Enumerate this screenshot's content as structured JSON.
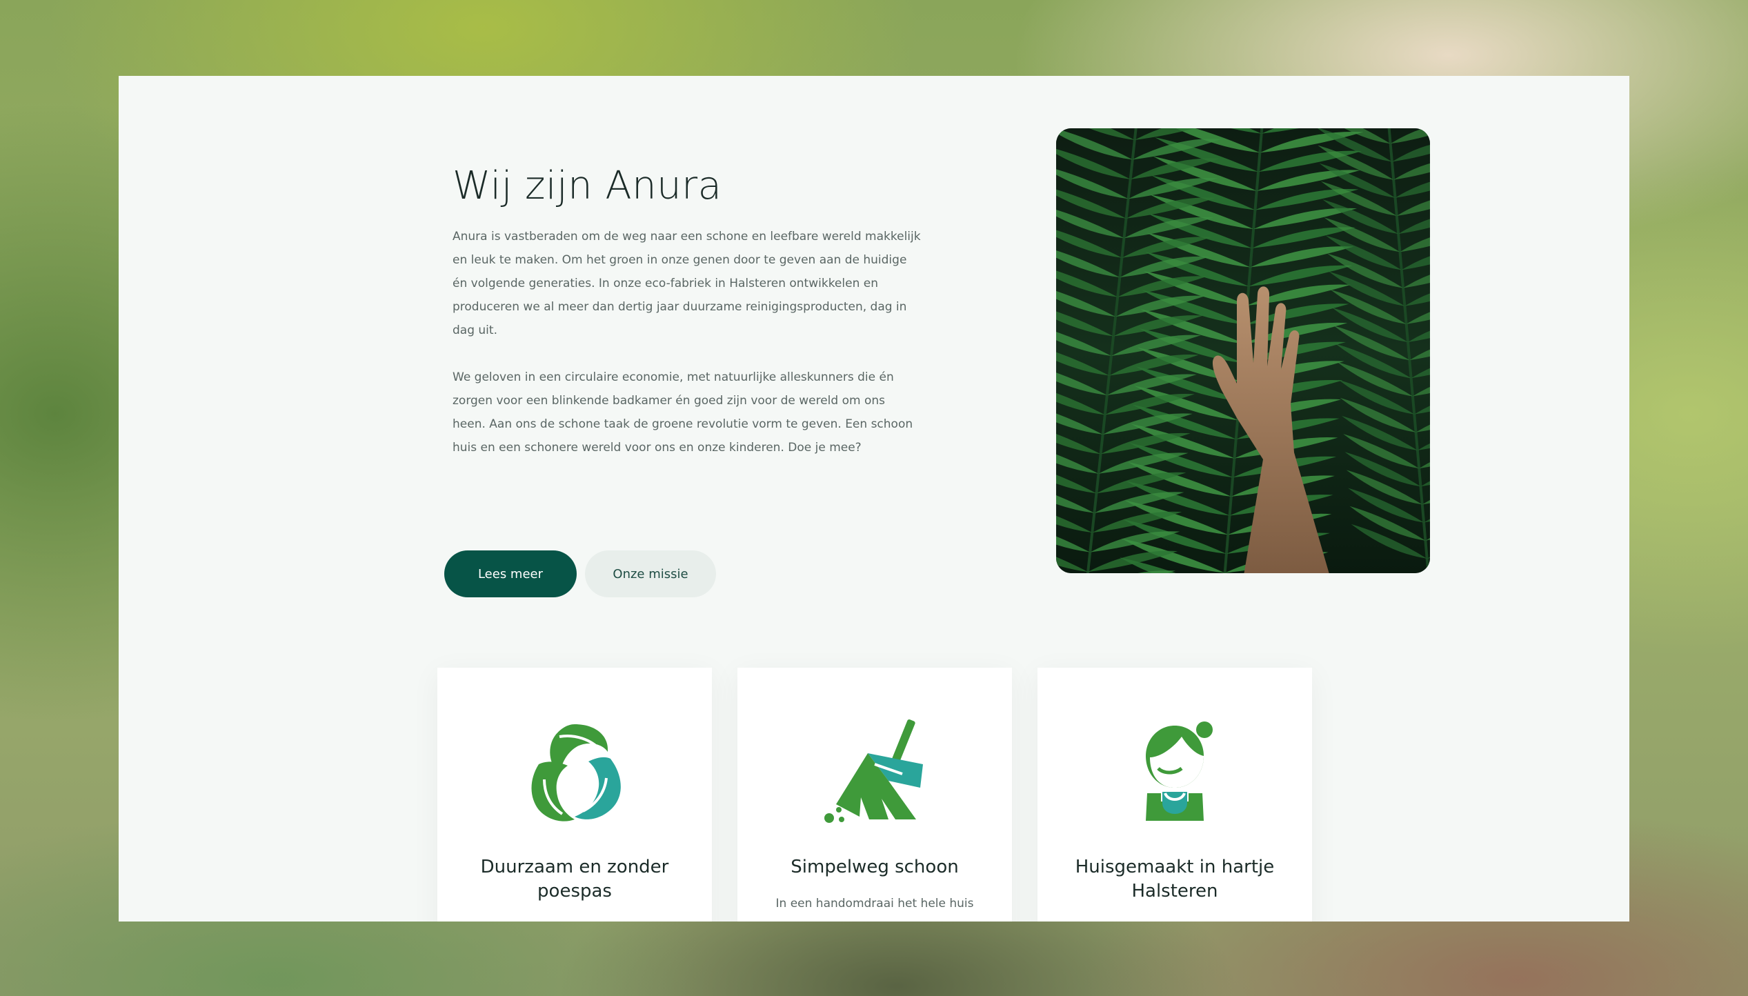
{
  "about": {
    "title": "Wij zijn Anura",
    "paragraph_1": "Anura is vastberaden om de weg naar een schone en leefbare wereld makkelijk en leuk te maken. Om het groen in onze genen door te geven aan de huidige én volgende generaties. In onze eco-fabriek in Halsteren ontwikkelen en produceren we al meer dan dertig jaar duurzame reinigingsproducten, dag in dag uit.",
    "paragraph_2": "We geloven in een circulaire economie, met natuurlijke alleskunners die én zorgen voor een blinkende badkamer én goed zijn voor de wereld om ons heen. Aan ons de schone taak de groene revolutie vorm te geven. Een schoon huis en een schonere wereld voor ons en onze kinderen. Doe je mee?",
    "buttons": {
      "primary_label": "Lees meer",
      "secondary_label": "Onze missie"
    },
    "image_icon": "hand-on-fern-leaves-photo"
  },
  "cards": [
    {
      "icon": "recycle-leaves-icon",
      "title": "Duurzaam en zonder poespas",
      "text": ""
    },
    {
      "icon": "broom-icon",
      "title": "Simpelweg schoon",
      "text": "In een handomdraai het hele huis"
    },
    {
      "icon": "person-icon",
      "title": "Huisgemaakt in hartje Halsteren",
      "text": ""
    }
  ],
  "colors": {
    "brand_green": "#075447",
    "icon_green": "#3f9a3a",
    "icon_teal": "#2aa59b",
    "page_background": "#f5f8f6"
  }
}
